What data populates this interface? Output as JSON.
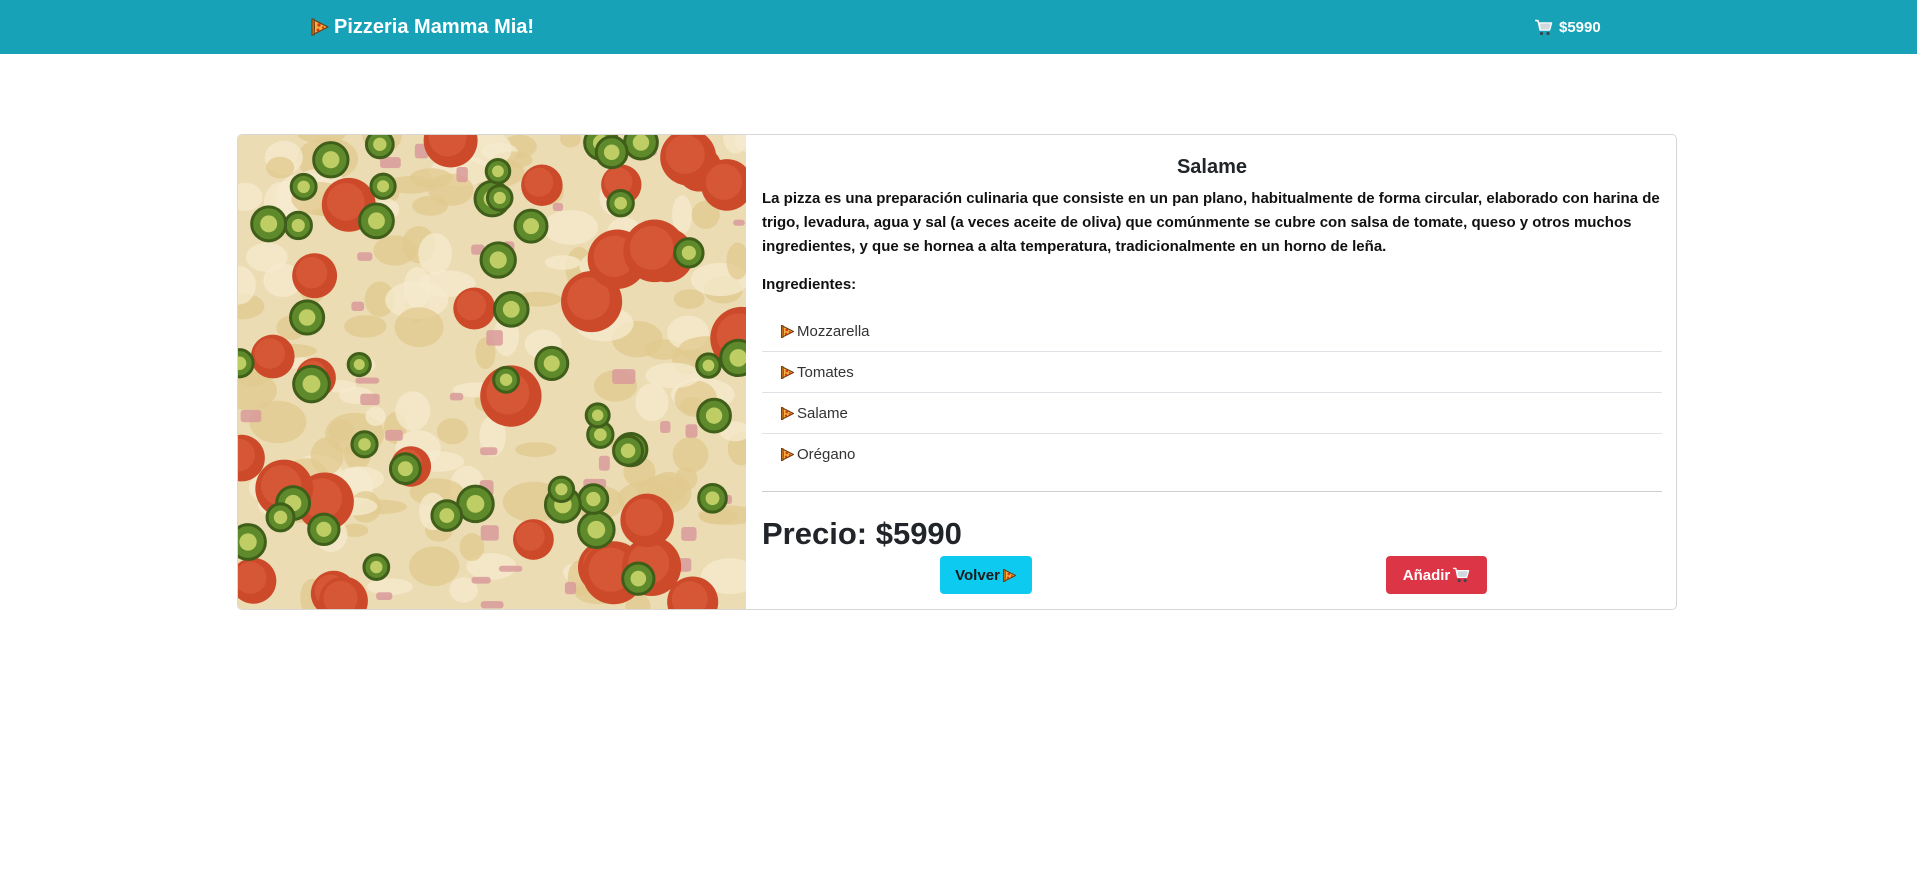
{
  "navbar": {
    "brand_icon": "pizza-slice-icon",
    "brand": "Pizzeria Mamma Mia!",
    "cart_icon": "cart-icon",
    "cart_total": "$5990"
  },
  "pizza": {
    "image_description": "pizza-photo",
    "name": "Salame",
    "description": "La pizza es una preparación culinaria que consiste en un pan plano, habitualmente de forma circular, elaborado con harina de trigo, levadura, agua y sal (a veces aceite de oliva) que comúnmente se cubre con salsa de tomate, queso y otros muchos ingredientes, y que se hornea a alta temperatura, tradicionalmente en un horno de leña.",
    "ingredients_title": "Ingredientes:",
    "ingredient_icon": "pizza-slice-icon",
    "ingredients": [
      "Mozzarella",
      "Tomates",
      "Salame",
      "Orégano"
    ],
    "price": "Precio: $5990"
  },
  "buttons": {
    "back_label": "Volver",
    "back_icon": "pizza-slice-icon",
    "add_label": "Añadir",
    "add_icon": "cart-icon"
  },
  "colors": {
    "navbar": "#17a2b8",
    "back_button": "#0dcaf0",
    "add_button": "#dc3545"
  }
}
